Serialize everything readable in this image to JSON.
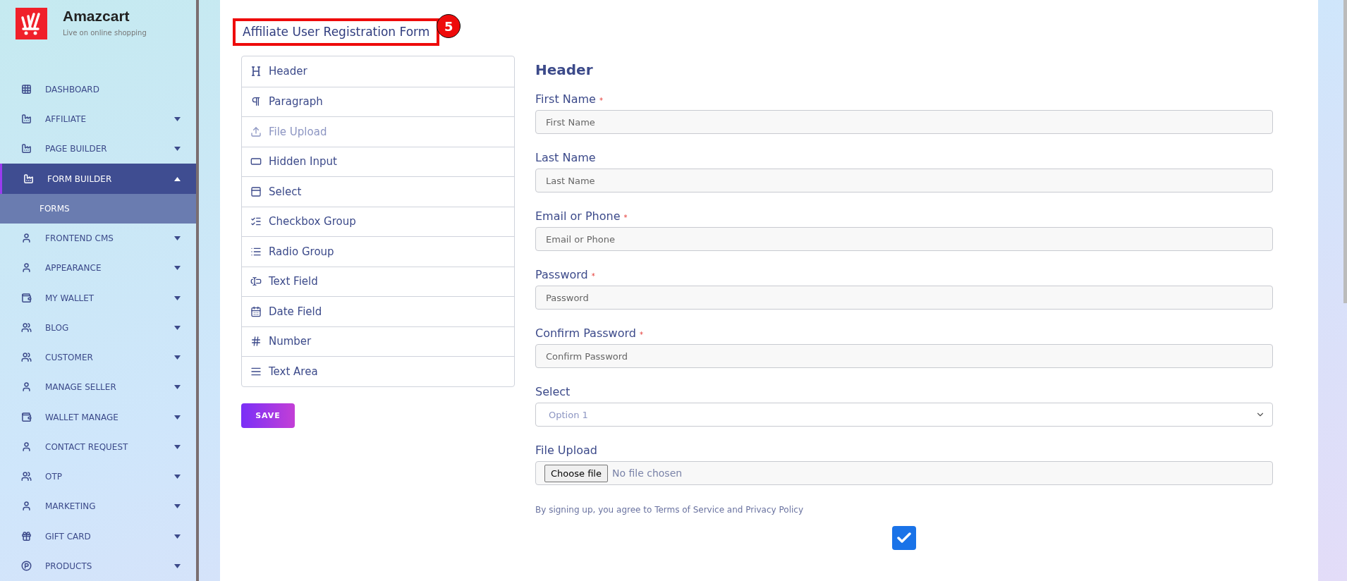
{
  "brand": {
    "name": "Amazcart",
    "tagline": "Live on online shopping"
  },
  "sidebar": {
    "items": [
      {
        "label": "DASHBOARD",
        "has_submenu": false,
        "selected": false
      },
      {
        "label": "AFFILIATE",
        "has_submenu": true,
        "expanded": false,
        "selected": false
      },
      {
        "label": "PAGE BUILDER",
        "has_submenu": true,
        "expanded": false,
        "selected": false
      },
      {
        "label": "FORM BUILDER",
        "has_submenu": true,
        "expanded": true,
        "selected": true,
        "children": [
          {
            "label": "FORMS",
            "selected": true
          }
        ]
      },
      {
        "label": "FRONTEND CMS",
        "has_submenu": true,
        "expanded": false,
        "selected": false
      },
      {
        "label": "APPEARANCE",
        "has_submenu": true,
        "expanded": false,
        "selected": false
      },
      {
        "label": "MY WALLET",
        "has_submenu": true,
        "expanded": false,
        "selected": false
      },
      {
        "label": "BLOG",
        "has_submenu": true,
        "expanded": false,
        "selected": false
      },
      {
        "label": "CUSTOMER",
        "has_submenu": true,
        "expanded": false,
        "selected": false
      },
      {
        "label": "MANAGE SELLER",
        "has_submenu": true,
        "expanded": false,
        "selected": false
      },
      {
        "label": "WALLET MANAGE",
        "has_submenu": true,
        "expanded": false,
        "selected": false
      },
      {
        "label": "CONTACT REQUEST",
        "has_submenu": true,
        "expanded": false,
        "selected": false
      },
      {
        "label": "OTP",
        "has_submenu": true,
        "expanded": false,
        "selected": false
      },
      {
        "label": "MARKETING",
        "has_submenu": true,
        "expanded": false,
        "selected": false
      },
      {
        "label": "GIFT CARD",
        "has_submenu": true,
        "expanded": false,
        "selected": false
      },
      {
        "label": "PRODUCTS",
        "has_submenu": true,
        "expanded": false,
        "selected": false
      }
    ]
  },
  "page": {
    "title": "Affiliate User Registration Form",
    "step_badge": "5"
  },
  "palette": [
    {
      "label": "Header",
      "disabled": false
    },
    {
      "label": "Paragraph",
      "disabled": false
    },
    {
      "label": "File Upload",
      "disabled": true
    },
    {
      "label": "Hidden Input",
      "disabled": false
    },
    {
      "label": "Select",
      "disabled": false
    },
    {
      "label": "Checkbox Group",
      "disabled": false
    },
    {
      "label": "Radio Group",
      "disabled": false
    },
    {
      "label": "Text Field",
      "disabled": false
    },
    {
      "label": "Date Field",
      "disabled": false
    },
    {
      "label": "Number",
      "disabled": false
    },
    {
      "label": "Text Area",
      "disabled": false
    }
  ],
  "save_button": "SAVE",
  "form": {
    "heading": "Header",
    "fields": [
      {
        "kind": "text",
        "label": "First Name",
        "required": true,
        "placeholder": "First Name"
      },
      {
        "kind": "text",
        "label": "Last Name",
        "required": false,
        "placeholder": "Last Name"
      },
      {
        "kind": "text",
        "label": "Email or Phone",
        "required": true,
        "placeholder": "Email or Phone"
      },
      {
        "kind": "text",
        "label": "Password",
        "required": true,
        "placeholder": "Password"
      },
      {
        "kind": "text",
        "label": "Confirm Password",
        "required": true,
        "placeholder": "Confirm Password"
      },
      {
        "kind": "select",
        "label": "Select",
        "required": false,
        "value": "Option 1"
      },
      {
        "kind": "file",
        "label": "File Upload",
        "required": false,
        "button": "Choose file",
        "status": "No file chosen"
      }
    ],
    "terms": "By signing up, you agree to Terms of Service and Privacy Policy",
    "agree_checked": true,
    "required_marker": "*"
  }
}
